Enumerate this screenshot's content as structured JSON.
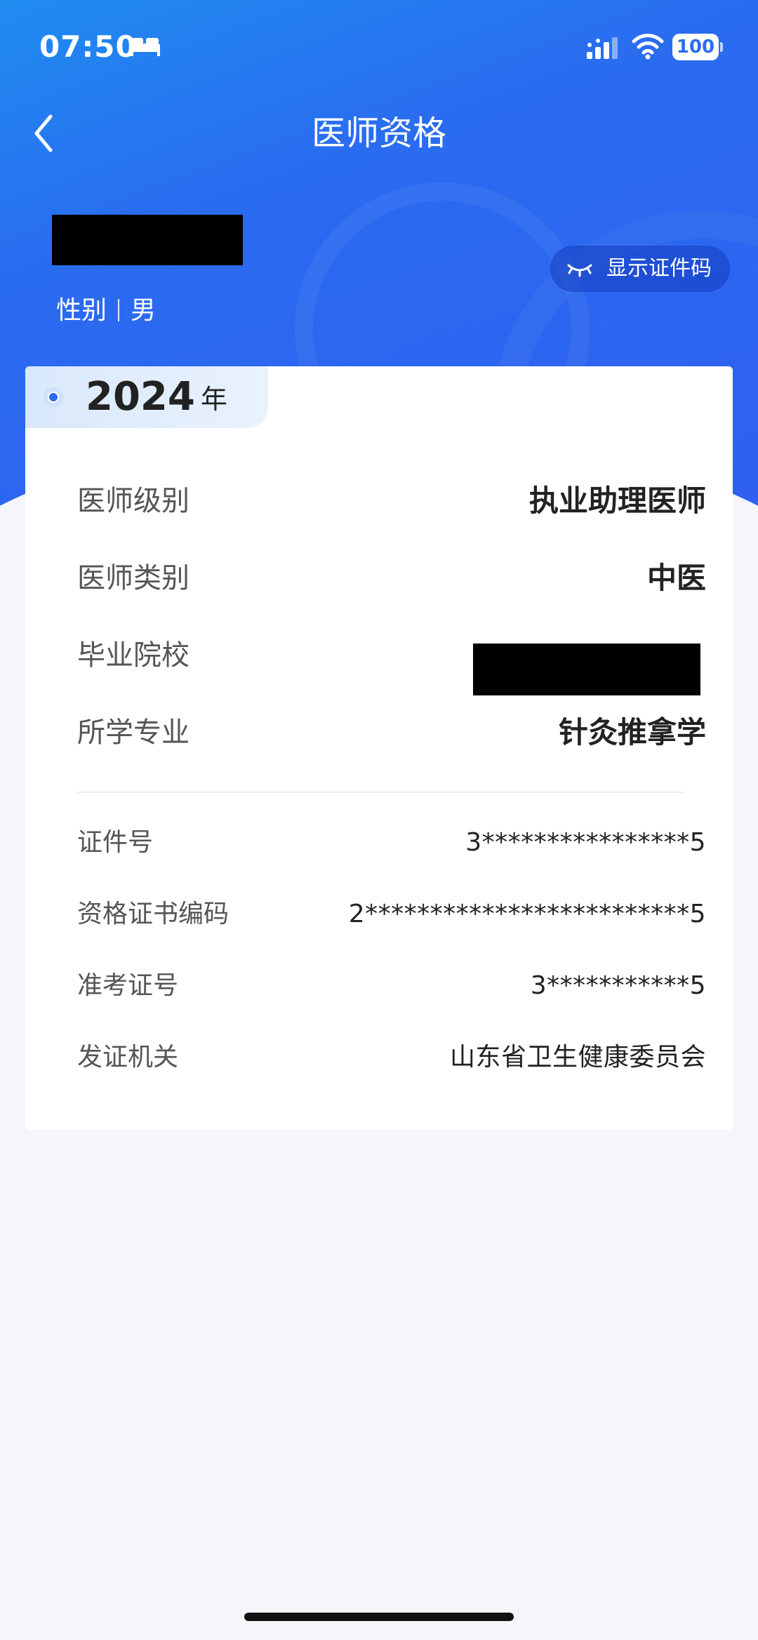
{
  "status_bar": {
    "time": "07:50",
    "battery": "100"
  },
  "nav": {
    "title": "医师资格"
  },
  "person": {
    "gender_label": "性别",
    "gender_value": "男"
  },
  "show_code_button": {
    "label": "显示证件码"
  },
  "card": {
    "year": "2024",
    "year_unit": "年",
    "main_rows": [
      {
        "label": "医师级别",
        "value": "执业助理医师"
      },
      {
        "label": "医师类别",
        "value": "中医"
      },
      {
        "label": "毕业院校",
        "value": ""
      },
      {
        "label": "所学专业",
        "value": "针灸推拿学"
      }
    ],
    "sub_rows": [
      {
        "label": "证件号",
        "value": "3****************5"
      },
      {
        "label": "资格证书编码",
        "value": "2*************************5"
      },
      {
        "label": "准考证号",
        "value": "3***********5"
      },
      {
        "label": "发证机关",
        "value": "山东省卫生健康委员会"
      }
    ]
  },
  "colors": {
    "accent": "#2a6cf0",
    "header_start": "#1f8cf0",
    "background": "#f4f6fa"
  }
}
